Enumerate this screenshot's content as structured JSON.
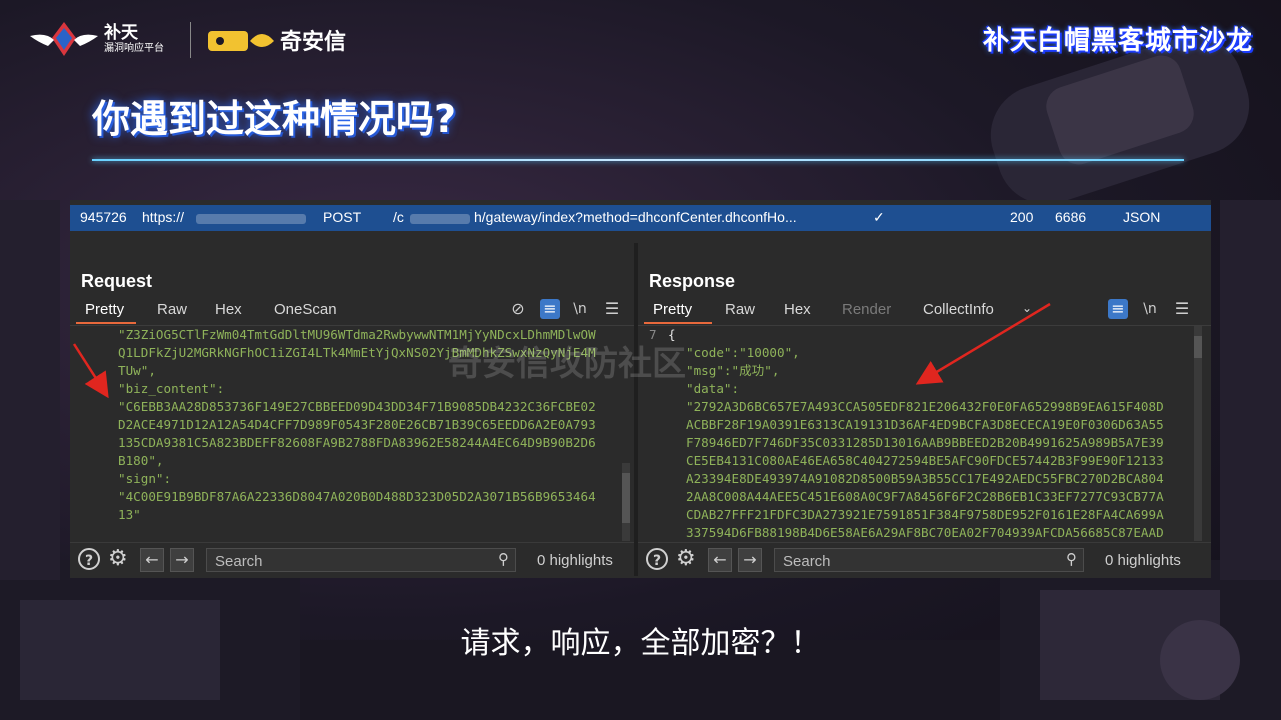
{
  "header": {
    "logo1_title": "补天",
    "logo1_subtitle": "漏洞响应平台",
    "logo2_name": "奇安信",
    "event_title": "补天白帽黑客城市沙龙"
  },
  "slide": {
    "title": "你遇到过这种情况吗?",
    "caption": "请求，响应，全部加密？！"
  },
  "history_row": {
    "id": "945726",
    "scheme": "https://",
    "method": "POST",
    "path_prefix": "/c",
    "path": "h/gateway/index?method=dhconfCenter.dhconfHo...",
    "check": "✓",
    "status": "200",
    "length": "6686",
    "mime": "JSON"
  },
  "request": {
    "title": "Request",
    "tabs": [
      "Pretty",
      "Raw",
      "Hex",
      "OneScan"
    ],
    "active_tab": "Pretty",
    "lines": [
      {
        "t": "\"Z3ZiOG5CTlFzWm04TmtGdDltMU96WTdma2RwbywwNTM1MjYyNDcxLDhmMDlwOW",
        "c": "k"
      },
      {
        "t": "Q1LDFkZjU2MGRkNGFhOC1iZGI4LTk4MmEtYjQxNS02YjBmMDhkZSwxNzQyNjE4M",
        "c": "k"
      },
      {
        "t": "TUw\",",
        "c": "k"
      },
      {
        "t": "\"biz_content\":",
        "c": "k"
      },
      {
        "t": "\"C6EBB3AA28D853736F149E27CBBEED09D43DD34F71B9085DB4232C36FCBE02",
        "c": "k"
      },
      {
        "t": "D2ACE4971D12A12A54D4CFF7D989F0543F280E26CB71B39C65EEDD6A2E0A793",
        "c": "k"
      },
      {
        "t": "135CDA9381C5A823BDEFF82608FA9B2788FDA83962E58244A4EC64D9B90B2D6",
        "c": "k"
      },
      {
        "t": "B180\",",
        "c": "k"
      },
      {
        "t": "\"sign\":",
        "c": "k"
      },
      {
        "t": "\"4C00E91B9BDF87A6A22336D8047A020B0D488D323D05D2A3071B56B9653464",
        "c": "k"
      },
      {
        "t": "13\"",
        "c": "k"
      },
      {
        "t": "}",
        "c": "w"
      }
    ],
    "search_placeholder": "Search",
    "highlights": "0 highlights"
  },
  "response": {
    "title": "Response",
    "tabs": [
      "Pretty",
      "Raw",
      "Hex",
      "Render",
      "CollectInfo"
    ],
    "active_tab": "Pretty",
    "disabled_tab": "Render",
    "line_number": "7",
    "lines": [
      {
        "t": "{",
        "c": "w"
      },
      {
        "t": "\"code\":\"10000\",",
        "c": "k"
      },
      {
        "t": "\"msg\":\"成功\",",
        "c": "k"
      },
      {
        "t": "\"data\":",
        "c": "k"
      },
      {
        "t": "\"2792A3D6BC657E7A493CCA505EDF821E206432F0E0FA652998B9EA615F408D",
        "c": "k"
      },
      {
        "t": "ACBBF28F19A0391E6313CA19131D36AF4ED9BCFA3D8ECECA19E0F0306D63A55",
        "c": "k"
      },
      {
        "t": "F78946ED7F746DF35C0331285D13016AAB9BBEED2B20B4991625A989B5A7E39",
        "c": "k"
      },
      {
        "t": "CE5EB4131C080AE46EA658C404272594BE5AFC90FDCE57442B3F99E90F12133",
        "c": "k"
      },
      {
        "t": "A23394E8DE493974A91082D8500B59A3B55CC17E492AEDC55FBC270D2BCA804",
        "c": "k"
      },
      {
        "t": "2AA8C008A44AEE5C451E608A0C9F7A8456F6F2C28B6EB1C33EF7277C93CB77A",
        "c": "k"
      },
      {
        "t": "CDAB27FFF21FDFC3DA273921E7591851F384F9758DE952F0161E28FA4CA699A",
        "c": "k"
      },
      {
        "t": "337594D6FB88198B4D6E58AE6A29AF8BC70EA02F704939AFCDA56685C87EAAD",
        "c": "k"
      }
    ],
    "search_placeholder": "Search",
    "highlights": "0 highlights"
  },
  "watermark": "奇安信攻防社区",
  "colors": {
    "accent_orange": "#e8693c",
    "selected_row": "#1e4f91",
    "code_green": "#8fb35a",
    "arrow_red": "#e0261f"
  },
  "icons": [
    "wrap-icon",
    "newline-icon",
    "menu-icon",
    "help-icon",
    "settings-icon",
    "back-icon",
    "forward-icon",
    "search-icon",
    "eye-off-icon",
    "chevron-down-icon"
  ]
}
